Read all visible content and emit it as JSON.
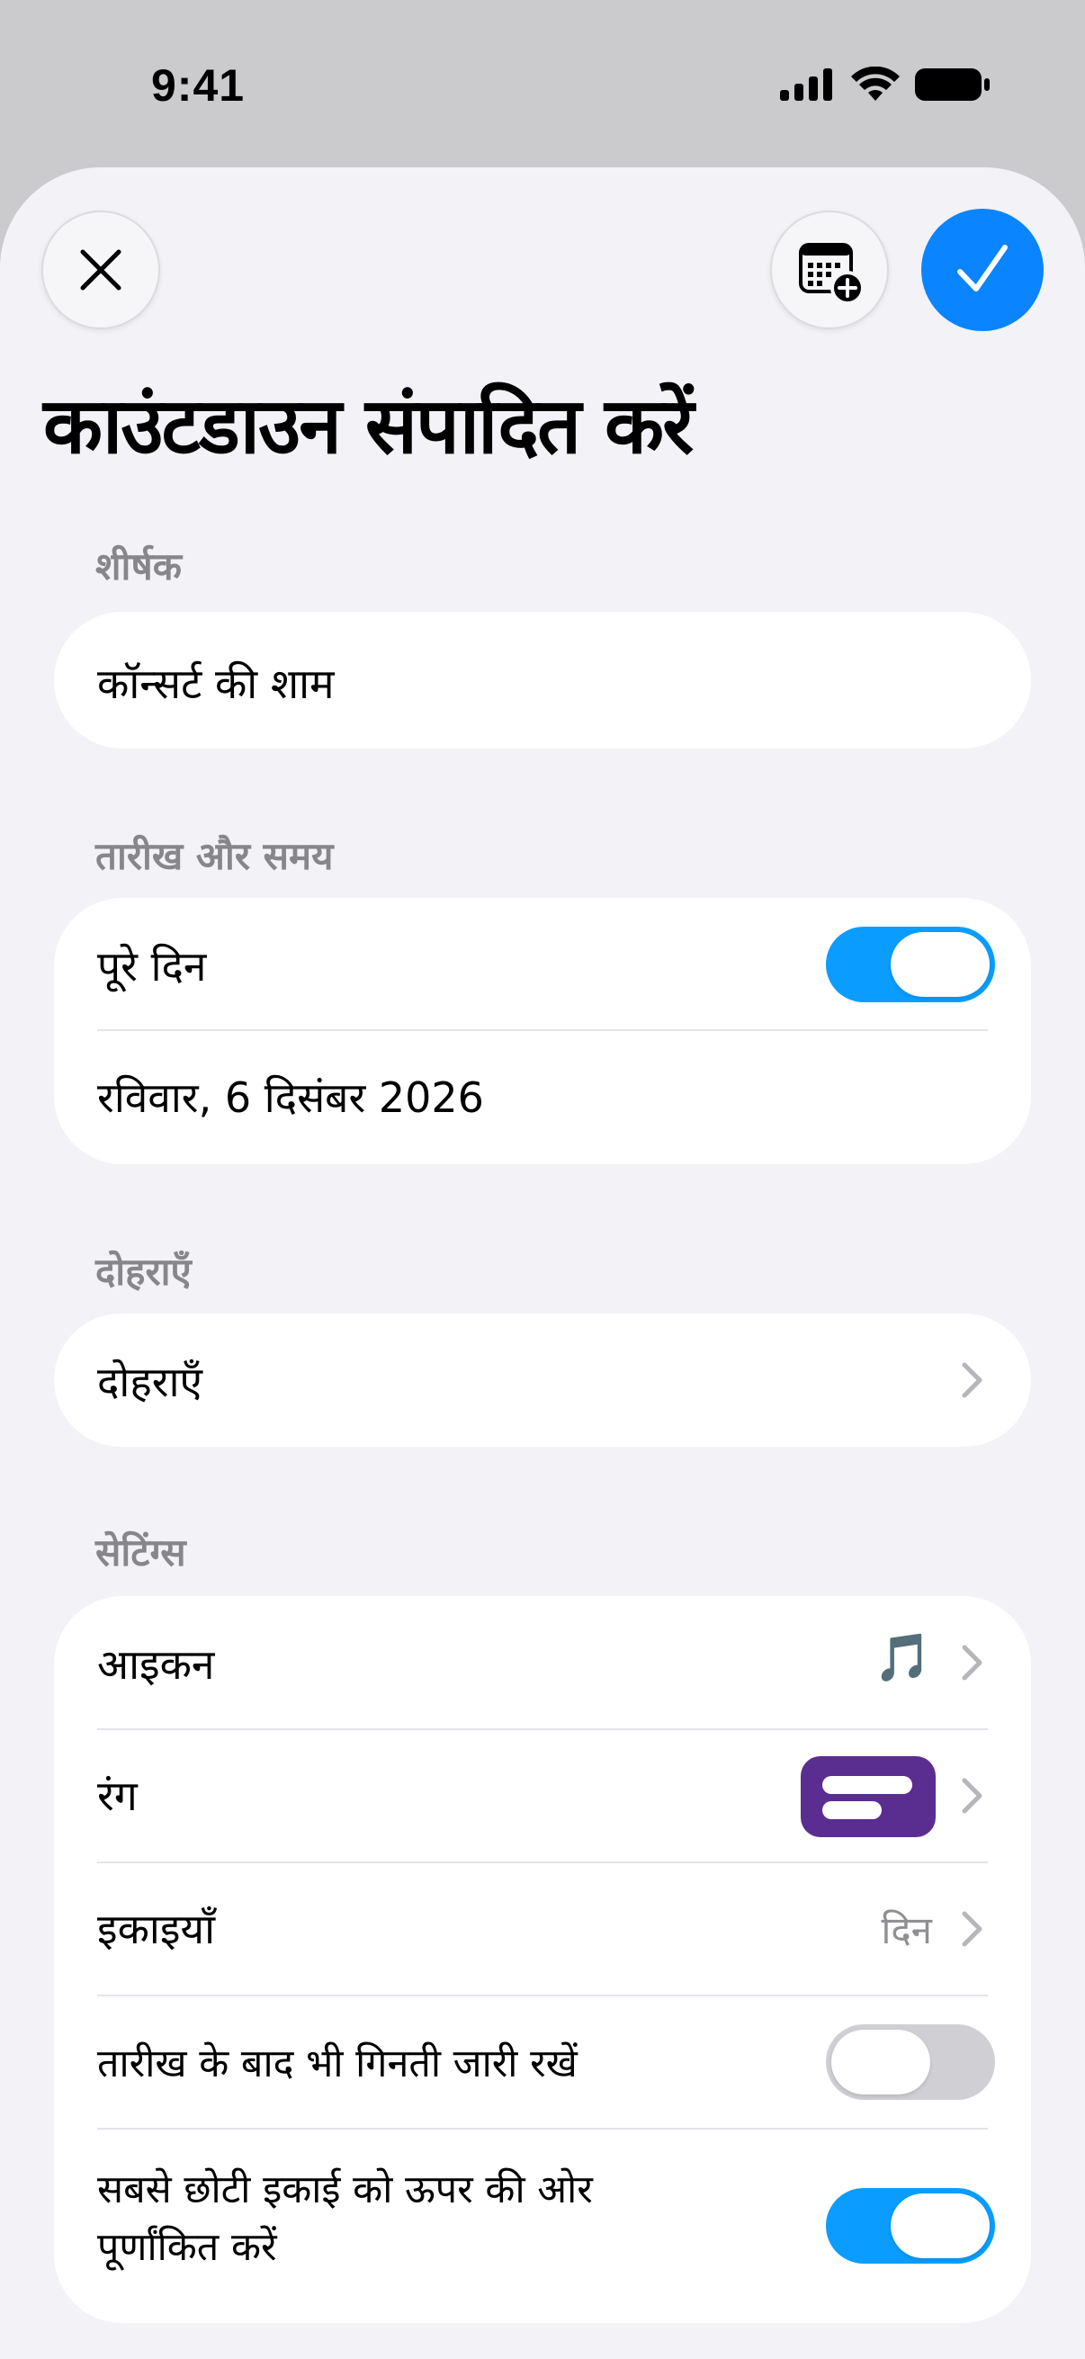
{
  "status": {
    "time": "9:41"
  },
  "header": {
    "close_icon": "close-icon",
    "calendar_icon": "calendar-add-icon",
    "confirm_icon": "checkmark-icon",
    "title": "काउंटडाउन संपादित करें"
  },
  "title_section": {
    "label": "शीर्षक",
    "value": "कॉन्सर्ट की शाम"
  },
  "datetime_section": {
    "label": "तारीख और समय",
    "all_day_label": "पूरे दिन",
    "all_day_on": true,
    "date_value": "रविवार, 6 दिसंबर 2026"
  },
  "repeat_section": {
    "label": "दोहराएँ",
    "row_label": "दोहराएँ"
  },
  "settings_section": {
    "label": "सेटिंग्स",
    "icon_label": "आइकन",
    "icon_value": "🎵",
    "color_label": "रंग",
    "color_value": "#5a2d91",
    "units_label": "इकाइयाँ",
    "units_value": "दिन",
    "continue_label": "तारीख के बाद भी गिनती जारी रखें",
    "continue_on": false,
    "round_label_line1": "सबसे छोटी इकाई को ऊपर की ओर",
    "round_label_line2": "पूर्णांकित करें",
    "round_on": true
  },
  "colors": {
    "accent": "#0a84ff",
    "toggle_on": "#0a9dff",
    "background": "#f2f2f7"
  }
}
